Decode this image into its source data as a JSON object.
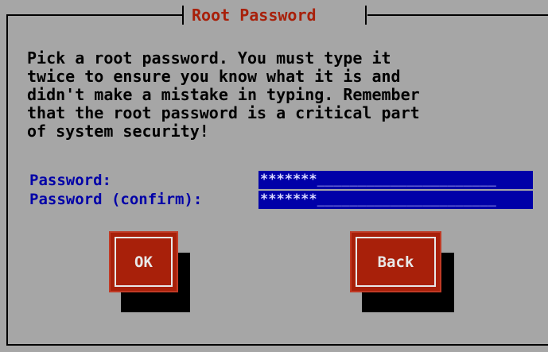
{
  "dialog": {
    "title": "Root Password",
    "message": "Pick a root password. You must type it\ntwice to ensure you know what it is and\ndidn't make a mistake in typing. Remember\nthat the root password is a critical part\nof system security!"
  },
  "fields": {
    "password": {
      "label": "Password:",
      "masked_value": "*******",
      "fill": "______________________"
    },
    "confirm": {
      "label": "Password (confirm):",
      "masked_value": "*******",
      "fill": "______________________"
    }
  },
  "buttons": {
    "ok_label": "OK",
    "back_label": "Back"
  },
  "colors": {
    "background": "#a6a6a6",
    "title": "#a8200a",
    "label": "#0000a8",
    "input_bg": "#0000a8",
    "button": "#a8200a"
  }
}
